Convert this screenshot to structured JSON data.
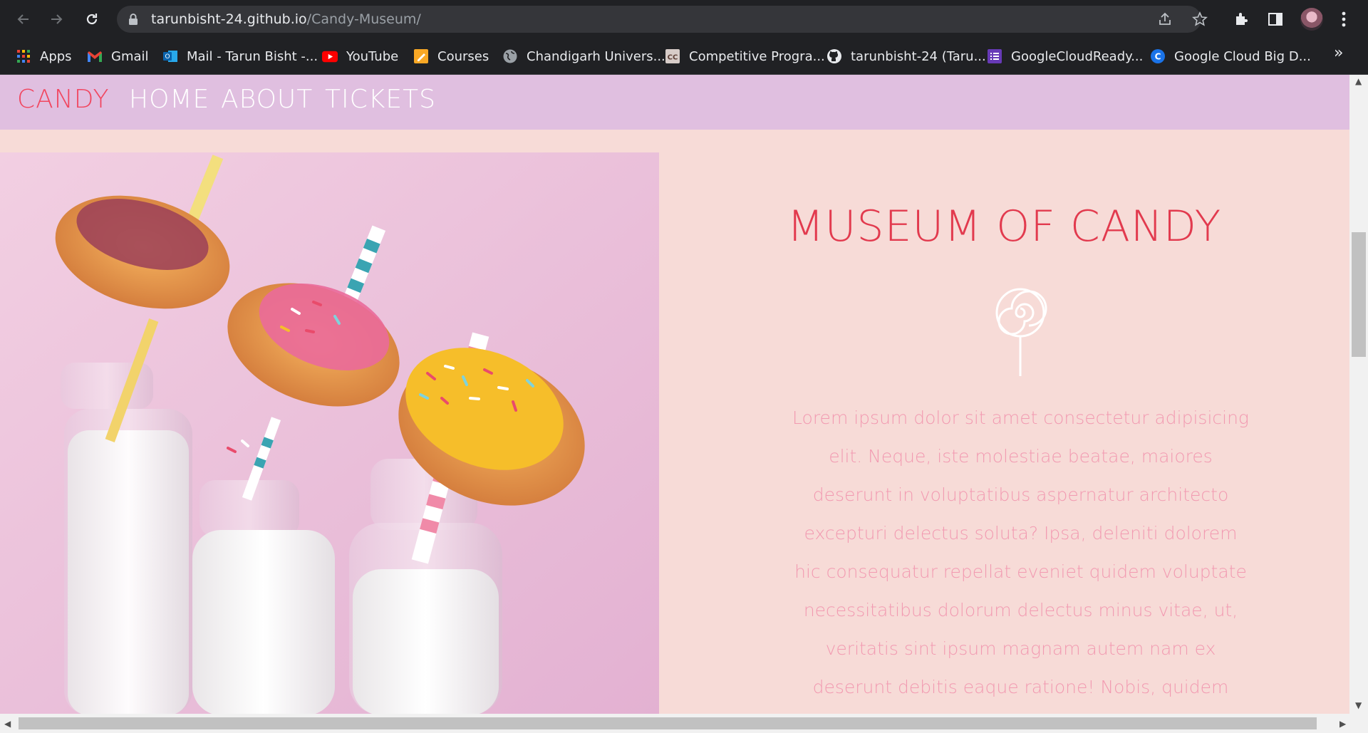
{
  "browser": {
    "url_domain": "tarunbisht-24.github.io",
    "url_path": "/Candy-Museum/",
    "bookmarks": [
      {
        "label": "Apps",
        "icon": "apps-grid-icon"
      },
      {
        "label": "Gmail",
        "icon": "gmail-icon"
      },
      {
        "label": "Mail - Tarun Bisht -...",
        "icon": "outlook-icon"
      },
      {
        "label": "YouTube",
        "icon": "youtube-icon"
      },
      {
        "label": "Courses",
        "icon": "courses-icon"
      },
      {
        "label": "Chandigarh Univers...",
        "icon": "globe-icon"
      },
      {
        "label": "Competitive Progra...",
        "icon": "cc-icon"
      },
      {
        "label": "tarunbisht-24 (Taru...",
        "icon": "github-icon"
      },
      {
        "label": "GoogleCloudReady...",
        "icon": "list-icon"
      },
      {
        "label": "Google Cloud Big D...",
        "icon": "c-icon"
      }
    ],
    "bookmarks_more": "»"
  },
  "site": {
    "brand": "CANDY",
    "nav": [
      "HOME",
      "ABOUT",
      "TICKETS"
    ],
    "hero_title": "MUSEUM OF CANDY",
    "hero_text": "Lorem ipsum dolor sit amet consectetur adipisicing elit. Neque, iste molestiae beatae, maiores deserunt in voluptatibus aspernatur architecto excepturi delectus soluta? Ipsa, deleniti dolorem hic consequatur repellat eveniet quidem voluptate necessitatibus dolorum delectus minus vitae, ut, veritatis sint ipsum magnam autem nam ex deserunt debitis eaque ratione! Nobis, quidem"
  },
  "colors": {
    "brand": "#f1465f",
    "nav_bg": "#e0bfe0",
    "page_bg": "#f7dbd7",
    "title": "#e23a4e",
    "body_text": "#f29ab1"
  }
}
